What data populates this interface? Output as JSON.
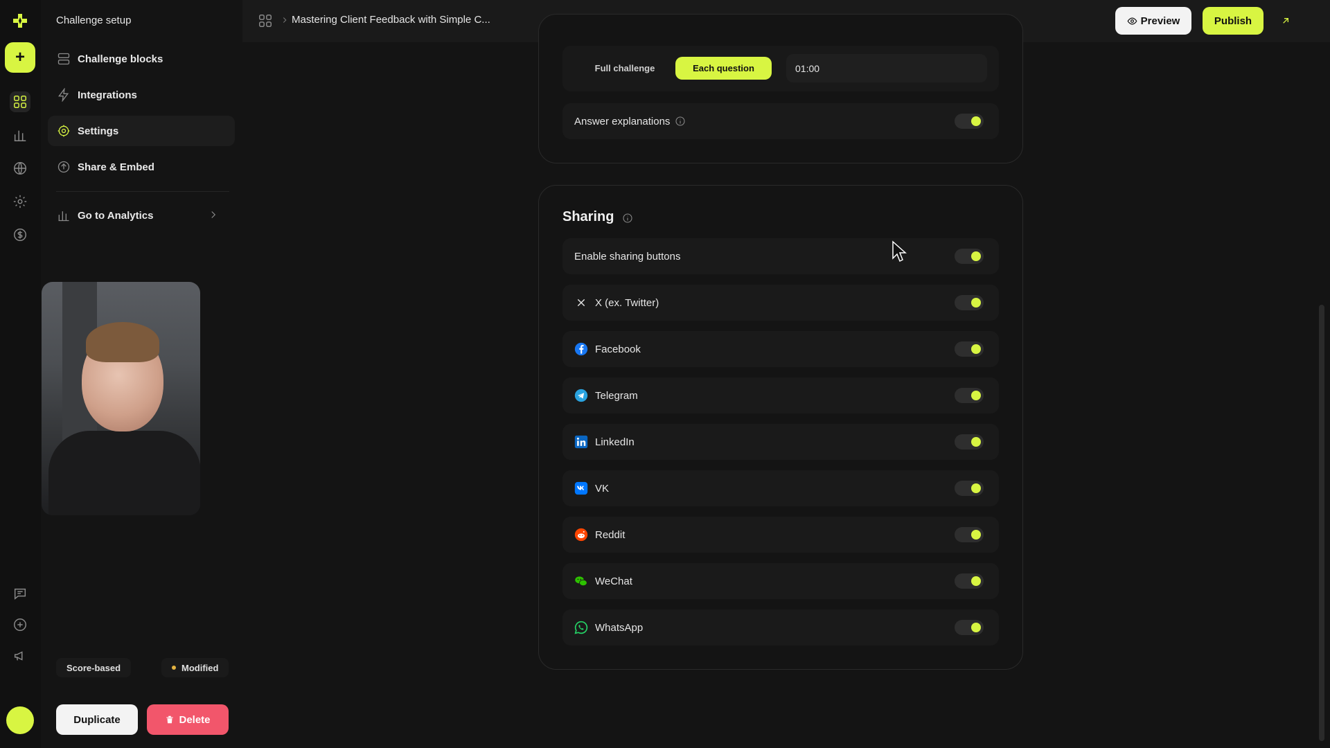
{
  "sidebar": {
    "title": "Challenge setup",
    "items": [
      {
        "label": "Challenge blocks"
      },
      {
        "label": "Integrations"
      },
      {
        "label": "Settings"
      },
      {
        "label": "Share & Embed"
      },
      {
        "label": "Go to Analytics"
      }
    ],
    "badge_type": "Score-based",
    "badge_status": "Modified",
    "duplicate_label": "Duplicate",
    "delete_label": "Delete"
  },
  "topbar": {
    "breadcrumb_title": "Mastering Client Feedback with Simple C...",
    "preview_label": "Preview",
    "publish_label": "Publish"
  },
  "timer": {
    "options": [
      "Full challenge",
      "Each question"
    ],
    "selected": "Each question",
    "value": "01:00"
  },
  "answer_explanations": {
    "label": "Answer explanations",
    "enabled": true
  },
  "sharing": {
    "title": "Sharing",
    "rows": [
      {
        "label": "Enable sharing buttons",
        "icon": "none",
        "enabled": true
      },
      {
        "label": "X (ex. Twitter)",
        "icon": "x-icon",
        "enabled": true
      },
      {
        "label": "Facebook",
        "icon": "facebook-icon",
        "enabled": true
      },
      {
        "label": "Telegram",
        "icon": "telegram-icon",
        "enabled": true
      },
      {
        "label": "LinkedIn",
        "icon": "linkedin-icon",
        "enabled": true
      },
      {
        "label": "VK",
        "icon": "vk-icon",
        "enabled": true
      },
      {
        "label": "Reddit",
        "icon": "reddit-icon",
        "enabled": true
      },
      {
        "label": "WeChat",
        "icon": "wechat-icon",
        "enabled": true
      },
      {
        "label": "WhatsApp",
        "icon": "whatsapp-icon",
        "enabled": true
      }
    ]
  },
  "colors": {
    "accent": "#d8f542",
    "danger": "#f2566b",
    "background": "#141414"
  }
}
